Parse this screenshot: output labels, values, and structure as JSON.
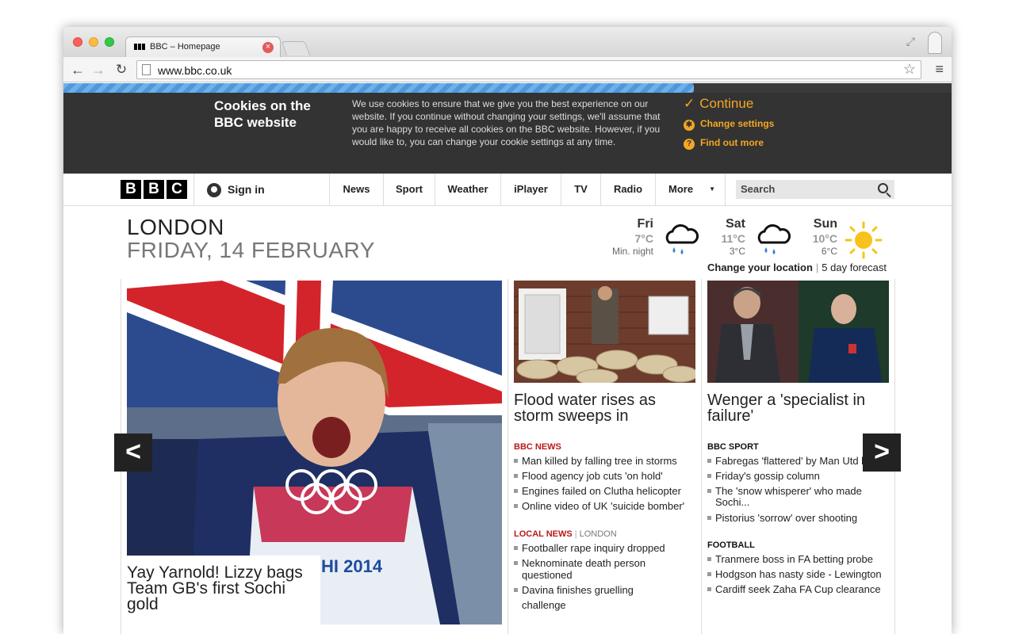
{
  "browser": {
    "tab_title": "BBC – Homepage",
    "tab_favicon": "BBC",
    "url": "www.bbc.co.uk",
    "load_progress": 0.71
  },
  "cookie": {
    "title": "Cookies on the BBC website",
    "text": "We use cookies to ensure that we give you the best experience on our website. If you continue without changing your settings, we'll assume that you are happy to receive all cookies on the BBC website. However, if you would like to, you can change your cookie settings at any time.",
    "continue_label": "Continue",
    "settings_label": "Change settings",
    "findout_label": "Find out more"
  },
  "nav": {
    "logo": [
      "B",
      "B",
      "C"
    ],
    "signin_label": "Sign in",
    "items": [
      "News",
      "Sport",
      "Weather",
      "iPlayer",
      "TV",
      "Radio",
      "More"
    ],
    "search_placeholder": "Search"
  },
  "location": {
    "city": "LONDON",
    "date": "FRIDAY, 14 FEBRUARY"
  },
  "weather": {
    "days": [
      {
        "name": "Fri",
        "high": "7°C",
        "low": "Min. night",
        "icon": "rain-cloud-icon"
      },
      {
        "name": "Sat",
        "high": "11°C",
        "low": "3°C",
        "icon": "rain-cloud-icon"
      },
      {
        "name": "Sun",
        "high": "10°C",
        "low": "6°C",
        "icon": "sun-icon"
      }
    ],
    "change_location": "Change your location",
    "separator": "|",
    "forecast_link": "5 day forecast"
  },
  "hero": {
    "caption": "Yay Yarnold! Lizzy bags Team GB's first Sochi gold",
    "bib_text": "HI 2014"
  },
  "stories": {
    "news_title": "Flood water rises as storm sweeps in",
    "sport_title": "Wenger a 'specialist in failure'"
  },
  "news": {
    "heading": "BBC NEWS",
    "items": [
      "Man killed by falling tree in storms",
      "Flood agency job cuts 'on hold'",
      "Engines failed on Clutha helicopter",
      "Online video of UK 'suicide bomber'"
    ],
    "local_heading": "LOCAL NEWS",
    "local_separator": "|",
    "local_place": "LONDON",
    "local_items": [
      "Footballer rape inquiry dropped",
      "Neknominate death person questioned",
      "Davina finishes gruelling challenge"
    ]
  },
  "sport": {
    "heading": "BBC SPORT",
    "items": [
      "Fabregas 'flattered' by Man Utd bid",
      "Friday's gossip column",
      "The 'snow whisperer' who made Sochi...",
      "Pistorius 'sorrow' over shooting"
    ],
    "football_heading": "FOOTBALL",
    "football_items": [
      "Tranmere boss in FA betting probe",
      "Hodgson has nasty side - Lewington",
      "Cardiff seek Zaha FA Cup clearance"
    ]
  },
  "carousel": {
    "prev_label": "<",
    "next_label": ">"
  },
  "colors": {
    "cookie_accent": "#f6a623",
    "news_red": "#bb1919",
    "banner_bg": "#333333"
  }
}
